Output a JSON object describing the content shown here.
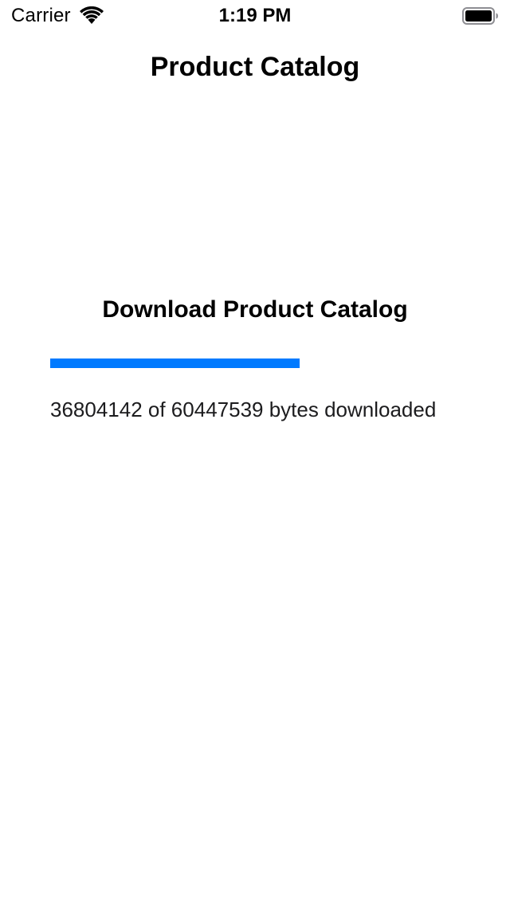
{
  "status_bar": {
    "carrier": "Carrier",
    "time": "1:19 PM",
    "wifi_icon": "wifi-icon",
    "battery_icon": "battery-icon"
  },
  "nav": {
    "title": "Product Catalog"
  },
  "download": {
    "heading": "Download Product Catalog",
    "progress_fraction": 0.6089,
    "bytes_downloaded": "36804142",
    "bytes_total": "60447539",
    "status_text": "36804142 of 60447539 bytes downloaded"
  },
  "colors": {
    "accent": "#007aff",
    "background": "#ffffff",
    "text": "#000000"
  }
}
